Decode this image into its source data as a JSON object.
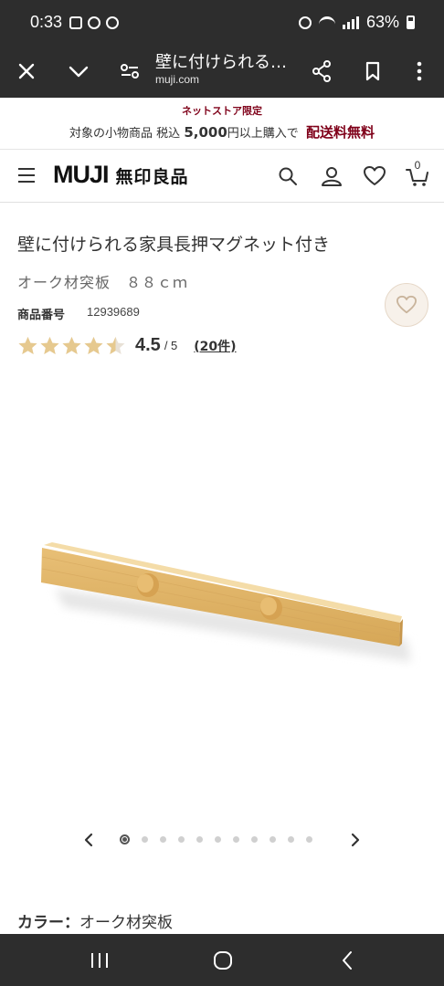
{
  "status_bar": {
    "time": "0:33",
    "battery": "63%"
  },
  "browser": {
    "title": "壁に付けられる…",
    "url": "muji.com",
    "icons": [
      "close-icon",
      "chevron-down-icon",
      "tune-icon",
      "share-icon",
      "bookmark-icon",
      "more-vert-icon"
    ]
  },
  "promo": {
    "label": "ネットストア限定",
    "text_prefix": "対象の小物商品 税込",
    "amount": "5,000",
    "text_suffix": "円以上購入で",
    "highlight": "配送料無料",
    "colors": {
      "accent": "#7f0019"
    }
  },
  "header": {
    "logo_latin": "MUJI",
    "logo_kanji": "無印良品",
    "cart_count": "0",
    "icons": [
      "menu-icon",
      "search-icon",
      "account-icon",
      "heart-icon",
      "cart-icon"
    ]
  },
  "product": {
    "title": "壁に付けられる家具長押マグネット付き",
    "variant": "オーク材突板　８８ｃｍ",
    "sku_label": "商品番号",
    "sku_value": "12939689",
    "rating": 4.5,
    "rating_value": "4.5",
    "rating_max": "/ 5",
    "review_count": "(20件)",
    "star_color": "#e6c98f",
    "image_alt": "oak wooden rail with two knobs"
  },
  "carousel": {
    "total": 11,
    "active_index": 0
  },
  "color_option": {
    "label": "カラー：",
    "value": "オーク材突板"
  }
}
